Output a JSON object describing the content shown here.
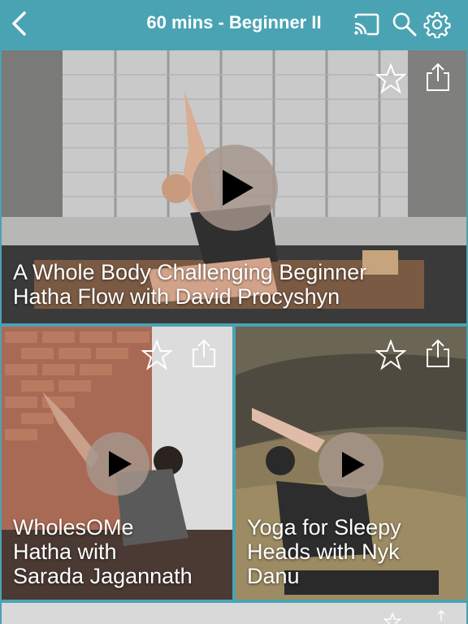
{
  "header": {
    "title": "60 mins - Beginner II",
    "icons": [
      "back-chevron-icon",
      "cast-icon",
      "search-icon",
      "gear-icon"
    ],
    "bar_color": "#4aa3b3"
  },
  "videos": [
    {
      "title_line1": "A Whole Body Challenging Beginner",
      "title_line2": "Hatha Flow with David Procyshyn",
      "icons": [
        "star-icon",
        "share-icon",
        "play-icon"
      ]
    },
    {
      "title_line1": "WholesOMe",
      "title_line2": "Hatha with",
      "title_line3": "Sarada Jagannath",
      "icons": [
        "star-icon",
        "share-icon",
        "play-icon"
      ]
    },
    {
      "title_line1": "Yoga for Sleepy",
      "title_line2": "Heads with Nyk",
      "title_line3": "Danu",
      "icons": [
        "star-icon",
        "share-icon",
        "play-icon"
      ]
    }
  ]
}
